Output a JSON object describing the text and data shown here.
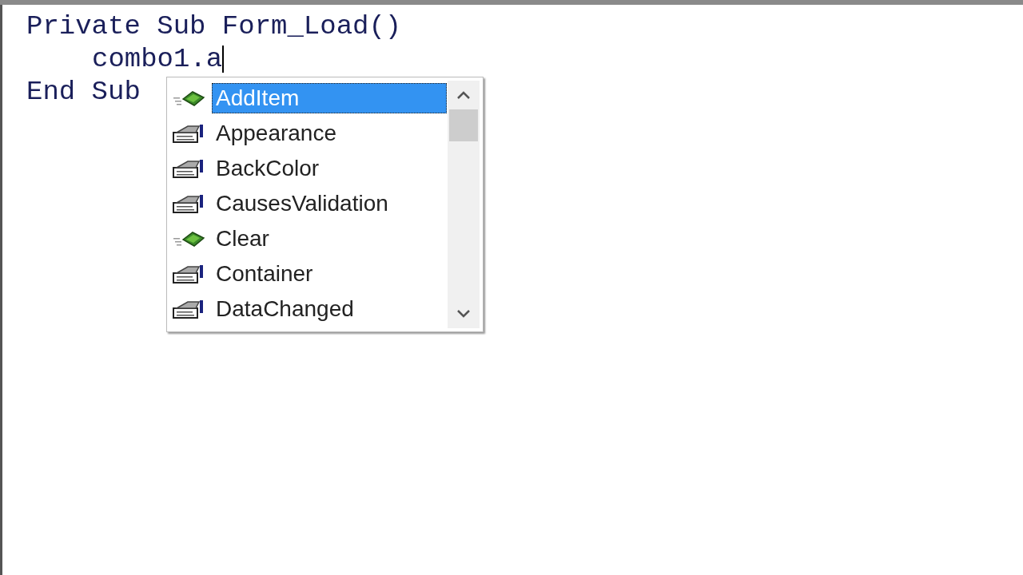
{
  "code_lines": [
    {
      "text": "Private Sub Form_Load()",
      "caret": false,
      "children": [
        {
          "text": "combo1.a",
          "caret": true
        }
      ]
    },
    {
      "text": "End Sub",
      "caret": false
    }
  ],
  "completion_list": {
    "items": [
      {
        "label": "AddItem",
        "kind": "method",
        "selected": true
      },
      {
        "label": "Appearance",
        "kind": "property",
        "selected": false
      },
      {
        "label": "BackColor",
        "kind": "property",
        "selected": false
      },
      {
        "label": "CausesValidation",
        "kind": "property",
        "selected": false
      },
      {
        "label": "Clear",
        "kind": "method",
        "selected": false
      },
      {
        "label": "Container",
        "kind": "property",
        "selected": false
      },
      {
        "label": "DataChanged",
        "kind": "property",
        "selected": false
      }
    ]
  }
}
